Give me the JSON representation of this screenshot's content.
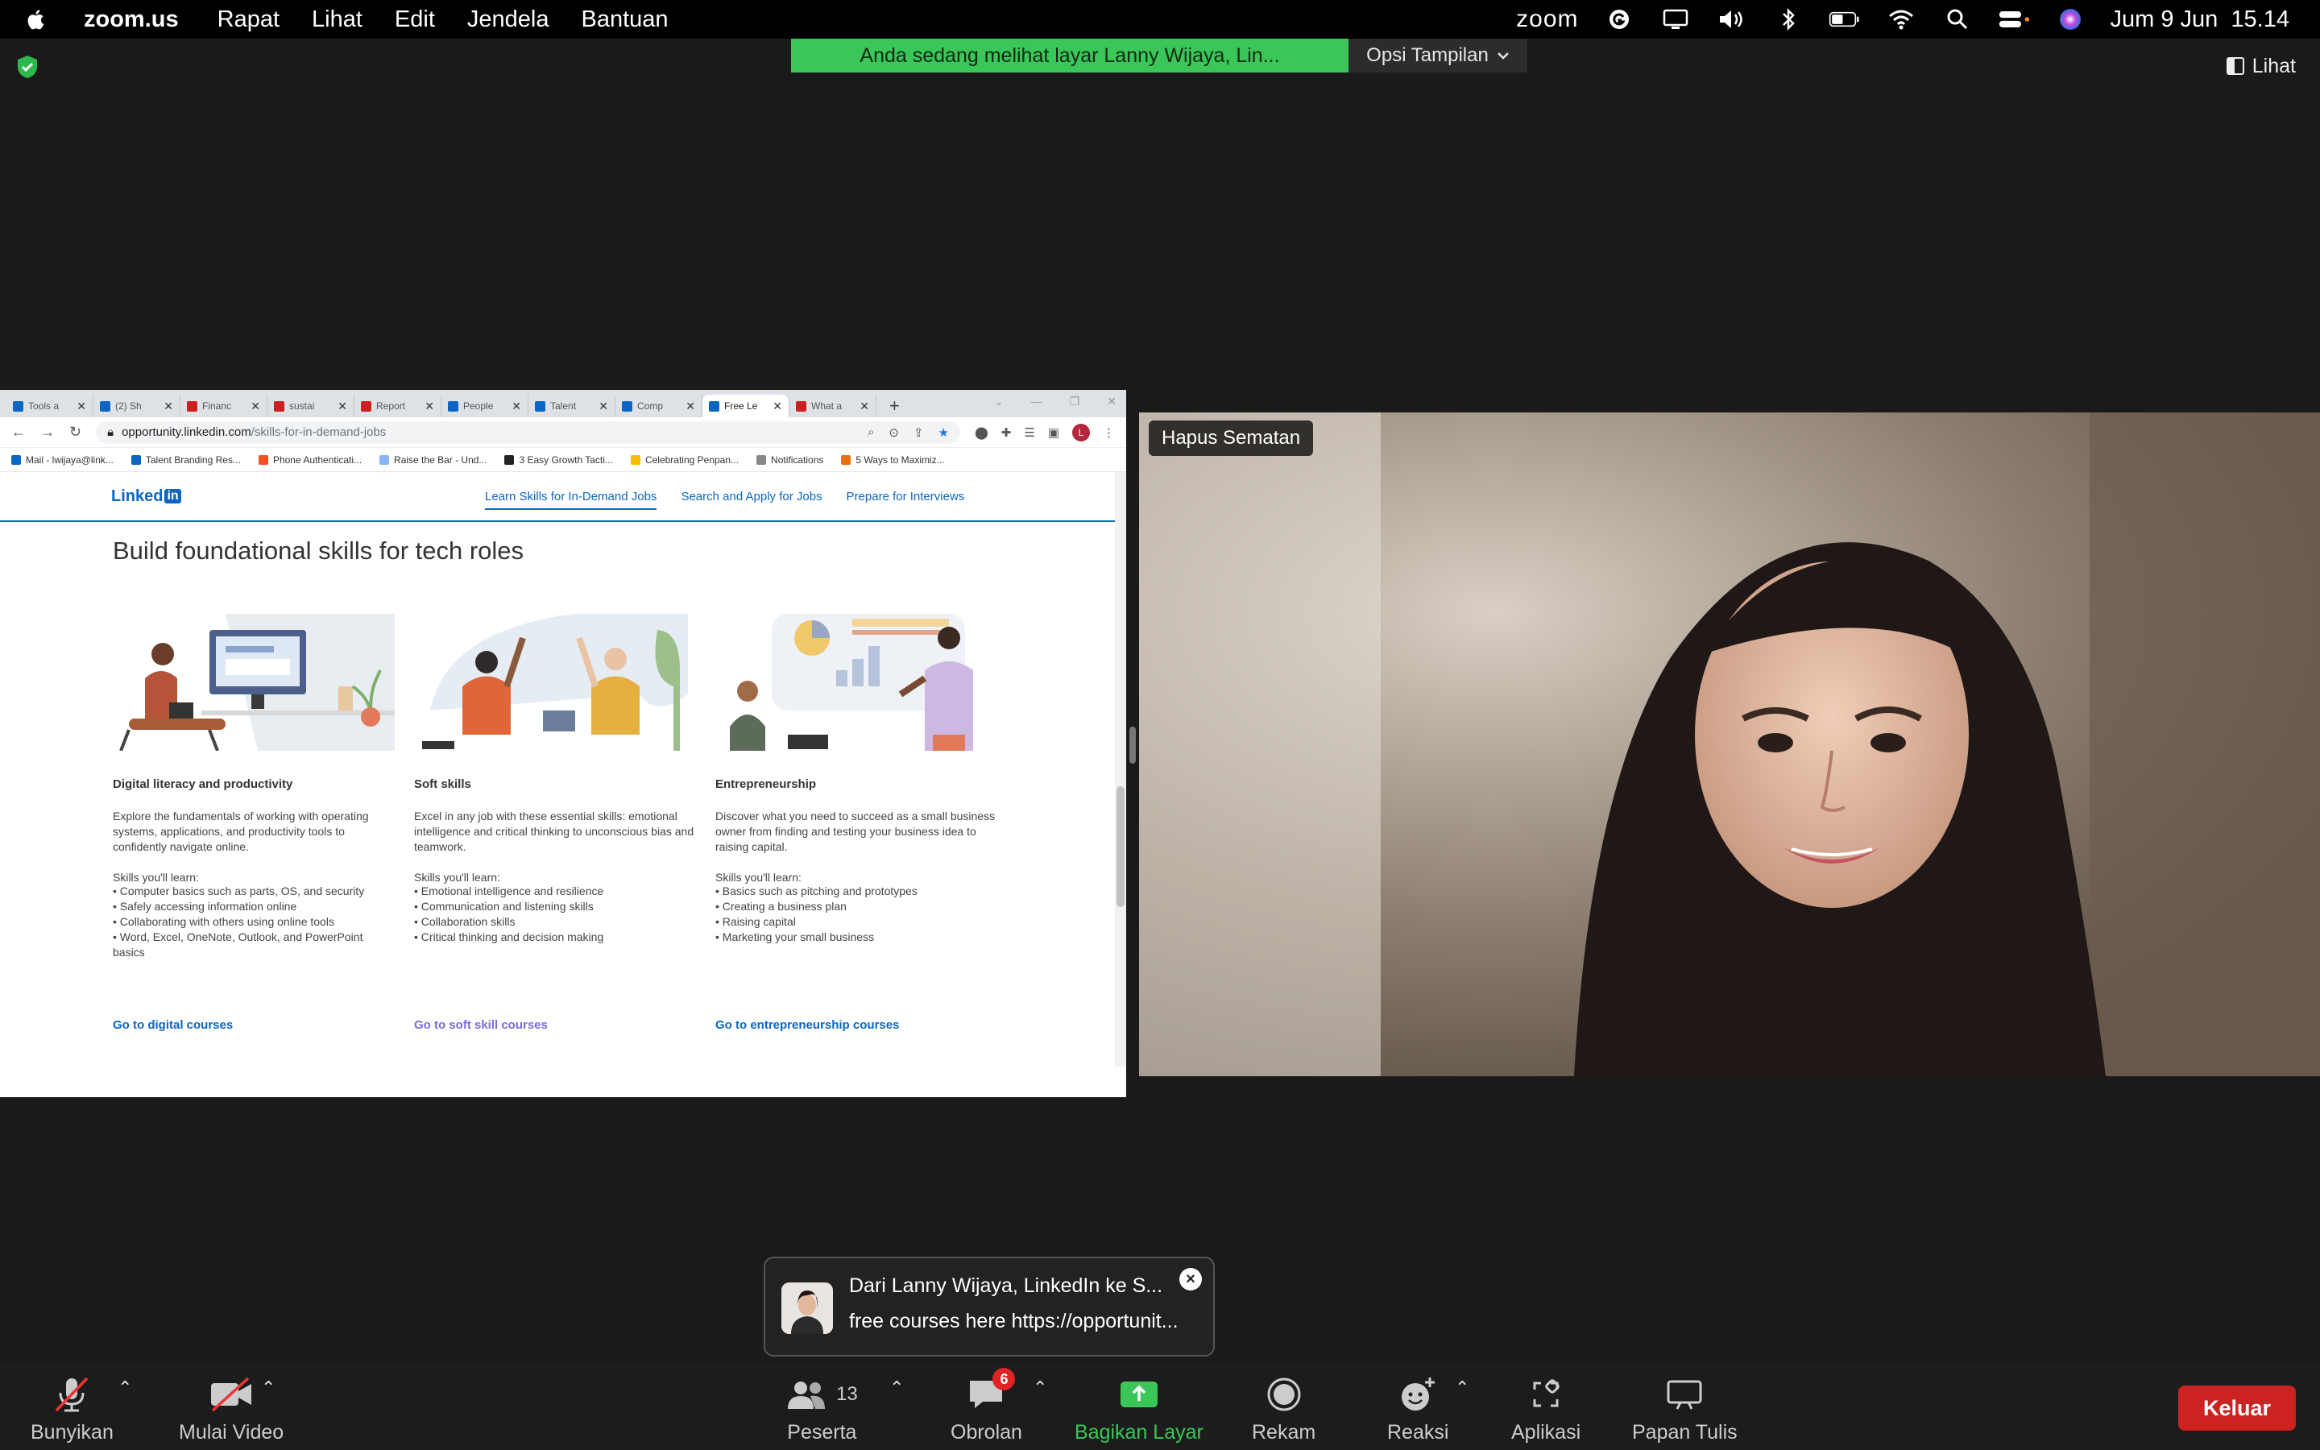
{
  "menubar": {
    "app_name": "zoom.us",
    "menus": [
      "Rapat",
      "Lihat",
      "Edit",
      "Jendela",
      "Bantuan"
    ],
    "zoom_logo": "zoom",
    "datetime": "Jum 9 Jun  15.14"
  },
  "banner": {
    "share_text": "Anda sedang melihat layar Lanny Wijaya, Lin...",
    "view_options": "Opsi Tampilan",
    "view_button": "Lihat"
  },
  "browser": {
    "tabs": [
      {
        "title": "Tools a",
        "icon": "linkedin"
      },
      {
        "title": "(2) Sh",
        "icon": "linkedin"
      },
      {
        "title": "Financ",
        "icon": "youtube"
      },
      {
        "title": "sustai",
        "icon": "youtube"
      },
      {
        "title": "Report",
        "icon": "youtube"
      },
      {
        "title": "People",
        "icon": "linkedin"
      },
      {
        "title": "Talent",
        "icon": "linkedin"
      },
      {
        "title": "Comp",
        "icon": "linkedin"
      },
      {
        "title": "Free Le",
        "icon": "linkedin",
        "active": true
      },
      {
        "title": "What a",
        "icon": "youtube"
      }
    ],
    "url_host": "opportunity.linkedin.com",
    "url_path": "/skills-for-in-demand-jobs",
    "profile_initial": "L",
    "bookmarks": [
      "Mail - lwijaya@link...",
      "Talent Branding Res...",
      "Phone Authenticati...",
      "Raise the Bar - Und...",
      "3 Easy Growth Tacti...",
      "Celebrating Penpan...",
      "Notifications",
      "5 Ways to Maximiz..."
    ]
  },
  "linkedin": {
    "logo_text": "Linked",
    "logo_in": "in",
    "nav": [
      "Learn Skills for In-Demand Jobs",
      "Search and Apply for Jobs",
      "Prepare for Interviews"
    ],
    "title": "Build foundational skills for tech roles",
    "cards": [
      {
        "title": "Digital literacy and productivity",
        "desc": "Explore the fundamentals of working with operating systems, applications, and productivity tools to confidently navigate online.",
        "sub": "Skills you'll learn:",
        "skills": [
          "Computer basics such as parts, OS, and security",
          "Safely accessing information online",
          "Collaborating with others using online tools",
          "Word, Excel, OneNote, Outlook, and PowerPoint basics"
        ],
        "link": "Go to digital courses"
      },
      {
        "title": "Soft skills",
        "desc": "Excel in any job with these essential skills: emotional intelligence and critical thinking to unconscious bias and teamwork.",
        "sub": "Skills you'll learn:",
        "skills": [
          "Emotional intelligence and resilience",
          "Communication and listening skills",
          "Collaboration skills",
          "Critical thinking and decision making"
        ],
        "link": "Go to soft skill courses"
      },
      {
        "title": "Entrepreneurship",
        "desc": "Discover what you need to succeed as a small business owner from finding and testing your business idea to raising capital.",
        "sub": "Skills you'll learn:",
        "skills": [
          "Basics such as pitching and prototypes",
          "Creating a business plan",
          "Raising capital",
          "Marketing your small business"
        ],
        "link": "Go to entrepreneurship courses"
      }
    ]
  },
  "video": {
    "name_tag": "Hapus Sematan"
  },
  "chat": {
    "from": "Dari Lanny Wijaya, LinkedIn ke S...",
    "message": "free courses here https://opportunit..."
  },
  "toolbar": {
    "unmute": "Bunyikan",
    "start_video": "Mulai Video",
    "participants": "Peserta",
    "participant_count": "13",
    "chat": "Obrolan",
    "chat_badge": "6",
    "share": "Bagikan Layar",
    "record": "Rekam",
    "reactions": "Reaksi",
    "apps": "Aplikasi",
    "whiteboard": "Papan Tulis",
    "leave": "Keluar"
  }
}
